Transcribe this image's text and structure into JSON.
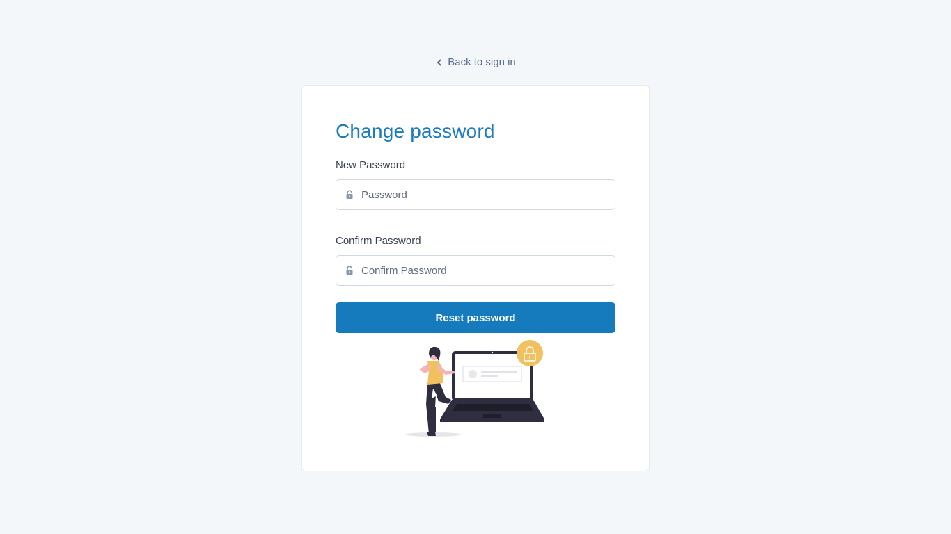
{
  "nav": {
    "back_label": "Back to sign in"
  },
  "form": {
    "title": "Change password",
    "new_password": {
      "label": "New Password",
      "placeholder": "Password",
      "value": ""
    },
    "confirm_password": {
      "label": "Confirm Password",
      "placeholder": "Confirm Password",
      "value": ""
    },
    "submit_label": "Reset password"
  },
  "icons": {
    "back": "chevron-left-icon",
    "field": "lock-icon",
    "illustration": "person-with-laptop-lock-illustration"
  },
  "colors": {
    "background": "#f4f7fa",
    "accent": "#157bbd",
    "title": "#1a7bbf",
    "illustration_yellow": "#f2c15f",
    "illustration_dark": "#2f2e41"
  }
}
